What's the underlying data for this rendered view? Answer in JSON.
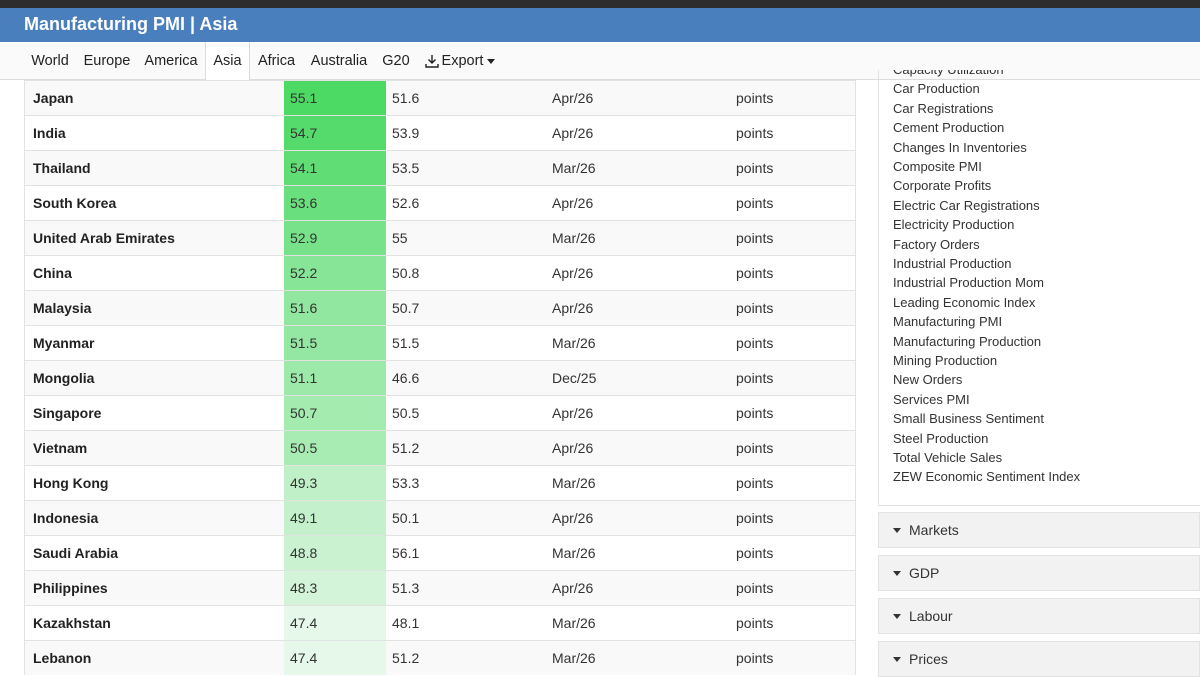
{
  "header": {
    "title": "Manufacturing PMI | Asia"
  },
  "nav": {
    "tabs": [
      "World",
      "Europe",
      "America",
      "Asia",
      "Africa",
      "Australia",
      "G20"
    ],
    "active": "Asia",
    "export_label": "Export"
  },
  "table": {
    "rows": [
      {
        "country": "Japan",
        "last": "55.1",
        "previous": "51.6",
        "reference": "Apr/26",
        "unit": "points"
      },
      {
        "country": "India",
        "last": "54.7",
        "previous": "53.9",
        "reference": "Apr/26",
        "unit": "points"
      },
      {
        "country": "Thailand",
        "last": "54.1",
        "previous": "53.5",
        "reference": "Mar/26",
        "unit": "points"
      },
      {
        "country": "South Korea",
        "last": "53.6",
        "previous": "52.6",
        "reference": "Apr/26",
        "unit": "points"
      },
      {
        "country": "United Arab Emirates",
        "last": "52.9",
        "previous": "55",
        "reference": "Mar/26",
        "unit": "points"
      },
      {
        "country": "China",
        "last": "52.2",
        "previous": "50.8",
        "reference": "Apr/26",
        "unit": "points"
      },
      {
        "country": "Malaysia",
        "last": "51.6",
        "previous": "50.7",
        "reference": "Apr/26",
        "unit": "points"
      },
      {
        "country": "Myanmar",
        "last": "51.5",
        "previous": "51.5",
        "reference": "Mar/26",
        "unit": "points"
      },
      {
        "country": "Mongolia",
        "last": "51.1",
        "previous": "46.6",
        "reference": "Dec/25",
        "unit": "points"
      },
      {
        "country": "Singapore",
        "last": "50.7",
        "previous": "50.5",
        "reference": "Apr/26",
        "unit": "points"
      },
      {
        "country": "Vietnam",
        "last": "50.5",
        "previous": "51.2",
        "reference": "Apr/26",
        "unit": "points"
      },
      {
        "country": "Hong Kong",
        "last": "49.3",
        "previous": "53.3",
        "reference": "Mar/26",
        "unit": "points"
      },
      {
        "country": "Indonesia",
        "last": "49.1",
        "previous": "50.1",
        "reference": "Apr/26",
        "unit": "points"
      },
      {
        "country": "Saudi Arabia",
        "last": "48.8",
        "previous": "56.1",
        "reference": "Mar/26",
        "unit": "points"
      },
      {
        "country": "Philippines",
        "last": "48.3",
        "previous": "51.3",
        "reference": "Apr/26",
        "unit": "points"
      },
      {
        "country": "Kazakhstan",
        "last": "47.4",
        "previous": "48.1",
        "reference": "Mar/26",
        "unit": "points"
      },
      {
        "country": "Lebanon",
        "last": "47.4",
        "previous": "51.2",
        "reference": "Mar/26",
        "unit": "points"
      }
    ]
  },
  "sidebar": {
    "indicators": [
      "Capacity Utilization",
      "Car Production",
      "Car Registrations",
      "Cement Production",
      "Changes In Inventories",
      "Composite PMI",
      "Corporate Profits",
      "Electric Car Registrations",
      "Electricity Production",
      "Factory Orders",
      "Industrial Production",
      "Industrial Production Mom",
      "Leading Economic Index",
      "Manufacturing PMI",
      "Manufacturing Production",
      "Mining Production",
      "New Orders",
      "Services PMI",
      "Small Business Sentiment",
      "Steel Production",
      "Total Vehicle Sales",
      "ZEW Economic Sentiment Index"
    ],
    "sections": [
      "Markets",
      "GDP",
      "Labour",
      "Prices"
    ]
  },
  "colors": {
    "header_bg": "#4a7fbd",
    "heat_high": "#4cd964",
    "heat_low": "#e6f8e9"
  }
}
